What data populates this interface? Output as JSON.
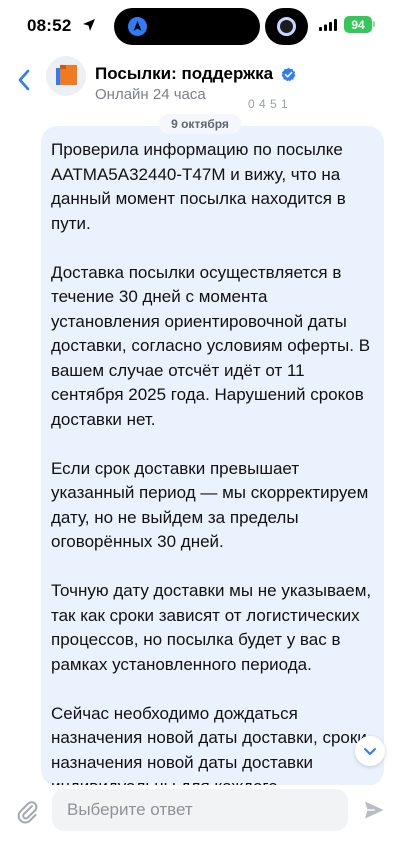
{
  "status_bar": {
    "time": "08:52",
    "battery_percent": "94"
  },
  "header": {
    "title": "Посылки: поддержка",
    "subtitle": "Онлайн 24 часа",
    "verified": true
  },
  "behind_message_time_partial": "0 4 5 1",
  "date_separator": "9 октября",
  "message": {
    "paragraphs": [
      "Проверила информацию по посылке AATMA5A32440-T47M и вижу, что на данный момент посылка находится в пути.",
      "Доставка посылки осуществляется в течение 30 дней с момента установления ориентировочной даты доставки, согласно условиям оферты. В вашем случае отсчёт идёт от 11 сентября 2025 года. Нарушений сроков доставки нет.",
      "Если срок доставки превышает указанный период — мы скорректируем дату, но не выйдем за пределы оговорённых 30 дней.",
      "Точную дату доставки мы не указываем, так как сроки зависят от логистических процессов, но посылка будет у вас в рамках установленного периода.",
      "Сейчас необходимо дождаться назначения новой даты доставки, сроки назначения новой даты доставки индивидуальны для каждого конкретного случая."
    ]
  },
  "input": {
    "placeholder": "Выберите ответ"
  },
  "colors": {
    "accent": "#2f7cf6",
    "bubble": "#eaf3fd",
    "battery": "#34c759",
    "verified": "#2f7cf6"
  },
  "icons": [
    "location-arrow-icon",
    "signal-icon",
    "wifi-icon",
    "back-chevron-icon",
    "verified-icon",
    "paperclip-icon",
    "send-icon",
    "chevron-down-icon"
  ]
}
